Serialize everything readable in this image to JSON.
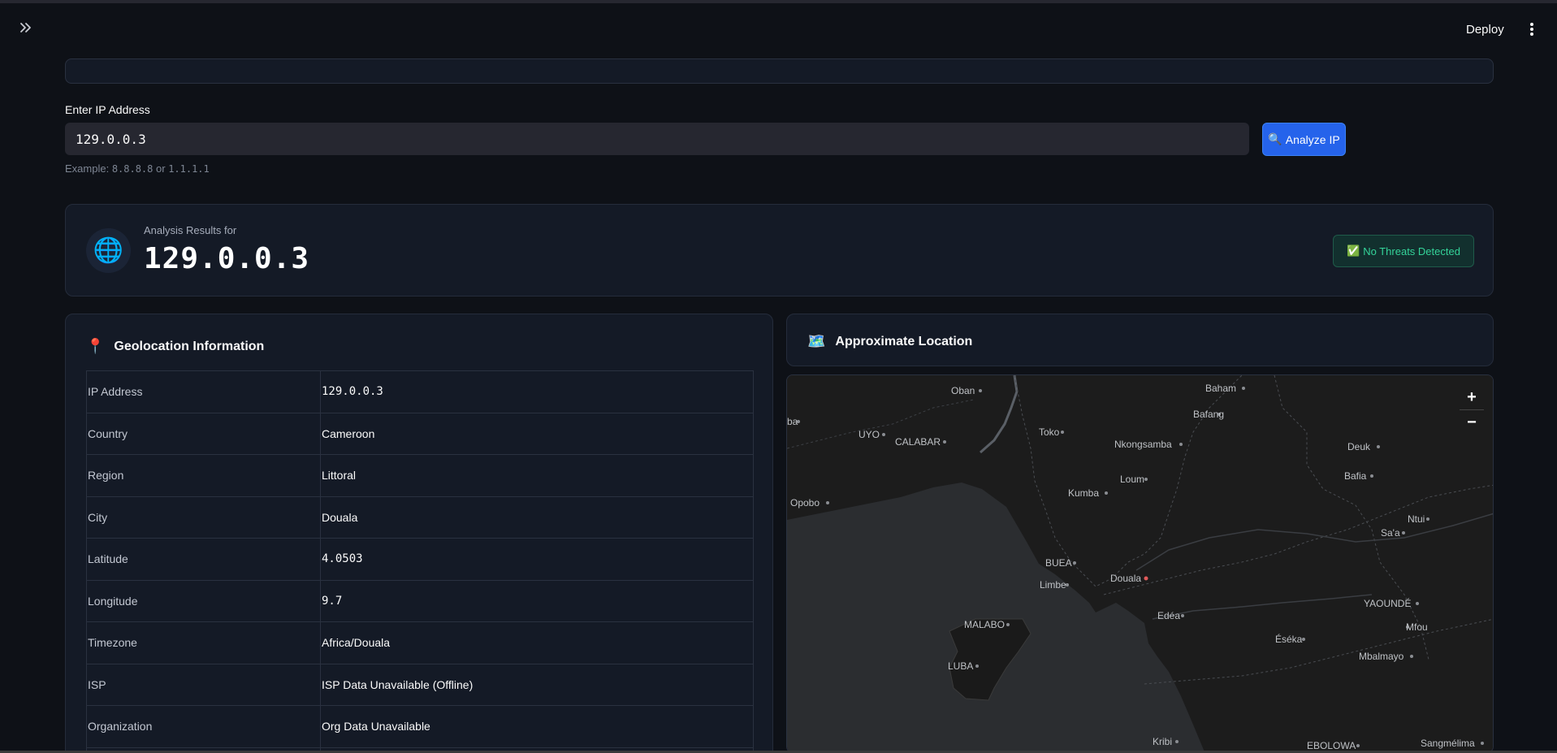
{
  "header": {
    "deploy_label": "Deploy"
  },
  "form": {
    "label": "Enter IP Address",
    "value": "129.0.0.3",
    "button_label": "Analyze IP",
    "button_icon": "🔍",
    "hint_prefix": "Example: ",
    "hint_example1": "8.8.8.8",
    "hint_or": " or ",
    "hint_example2": "1.1.1.1"
  },
  "results": {
    "subtitle": "Analysis Results for",
    "ip": "129.0.0.3",
    "icon": "🌐",
    "badge_icon": "✅",
    "badge_label": "No Threats Detected"
  },
  "geo": {
    "title": "Geolocation Information",
    "icon": "📍",
    "rows": [
      {
        "key": "IP Address",
        "value": "129.0.0.3"
      },
      {
        "key": "Country",
        "value": "Cameroon"
      },
      {
        "key": "Region",
        "value": "Littoral"
      },
      {
        "key": "City",
        "value": "Douala"
      },
      {
        "key": "Latitude",
        "value": "4.0503"
      },
      {
        "key": "Longitude",
        "value": "9.7"
      },
      {
        "key": "Timezone",
        "value": "Africa/Douala"
      },
      {
        "key": "ISP",
        "value": "ISP Data Unavailable (Offline)"
      },
      {
        "key": "Organization",
        "value": "Org Data Unavailable"
      }
    ]
  },
  "location": {
    "title": "Approximate Location",
    "icon": "🗺️"
  },
  "map": {
    "zoom_in": "+",
    "zoom_out": "−",
    "places": {
      "oban": "Oban",
      "baham": "Baham",
      "bafang": "Bafang",
      "uyo": "UYO",
      "calabar": "CALABAR",
      "toko": "Toko",
      "nkongsamba": "Nkongsamba",
      "deuk": "Deuk",
      "loum": "Loum",
      "bafia": "Bafia",
      "kumba": "Kumba",
      "opobo": "Opobo",
      "ntui": "Ntui",
      "saa": "Sa'a",
      "buea": "BUEA",
      "douala": "Douala",
      "limbe": "Limbe",
      "yaounde": "YAOUNDÉ",
      "edea": "Edéa",
      "malabo": "MALABO",
      "mfou": "Mfou",
      "eseka": "Éséka",
      "mbalmayo": "Mbalmayo",
      "luba": "LUBA",
      "kribi": "Kribi",
      "ebolowa": "EBOLOWA",
      "sangmelima": "Sangmélima",
      "aba": "ba"
    }
  }
}
